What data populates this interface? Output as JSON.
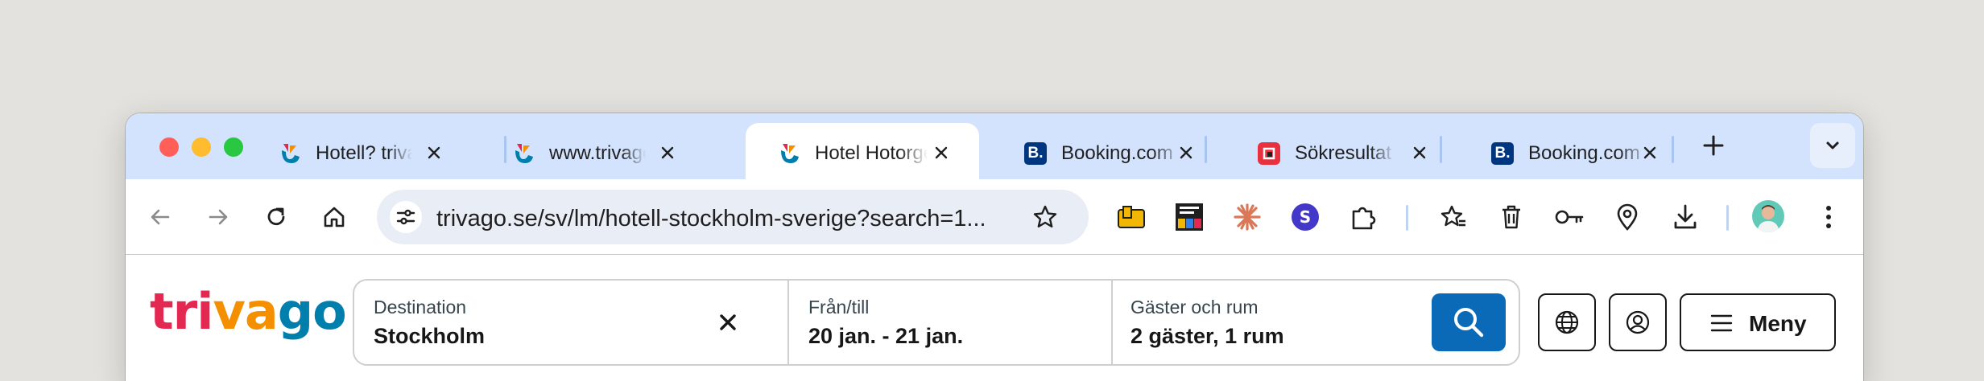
{
  "browser": {
    "tabs": [
      {
        "title": "Hotell? trivago",
        "favicon": "trivago-icon",
        "active": false
      },
      {
        "title": "www.trivago.se",
        "favicon": "trivago-icon",
        "active": false
      },
      {
        "title": "Hotel Hotorget",
        "favicon": "trivago-icon",
        "active": true
      },
      {
        "title": "Booking.com",
        "favicon": "booking-icon",
        "active": false
      },
      {
        "title": "Sökresultat för",
        "favicon": "red-app-icon",
        "active": false
      },
      {
        "title": "Booking.com",
        "favicon": "booking-icon",
        "active": false
      }
    ],
    "booking_favicon_text": "B.",
    "url": "trivago.se/sv/lm/hotell-stockholm-sverige?search=1...",
    "colors": {
      "tabstrip": "#d3e3fd",
      "omnibox": "#e9eef6"
    }
  },
  "site": {
    "logo": {
      "part1": "tri",
      "part2": "va",
      "part3": "go"
    },
    "search": {
      "destination_label": "Destination",
      "destination_value": "Stockholm",
      "dates_label": "Från/till",
      "dates_value": "20 jan. - 21 jan.",
      "guests_label": "Gäster och rum",
      "guests_value": "2 gäster, 1 rum"
    },
    "menu_label": "Meny",
    "colors": {
      "search_button": "#0a6ab8",
      "logo_red": "#e32851",
      "logo_orange": "#f48f00",
      "logo_blue": "#007fad"
    }
  }
}
